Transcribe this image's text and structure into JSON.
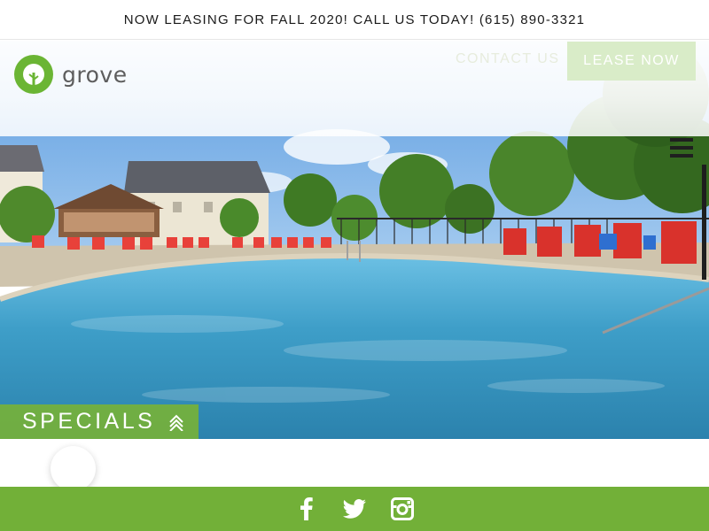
{
  "announcement": {
    "text": "NOW LEASING FOR FALL 2020! CALL US TODAY! (615) 890-3321"
  },
  "header": {
    "logo_text": "grove",
    "logo_icon": "tree-leaf-icon",
    "contact_label": "CONTACT US",
    "lease_label": "LEASE NOW",
    "menu_icon": "hamburger-menu-icon"
  },
  "hero": {
    "image_icon": "pool-photo"
  },
  "specials": {
    "label": "SPECIALS",
    "icon": "double-chevron-up-icon"
  },
  "chat": {
    "icon": "chat-bubble-icon"
  },
  "footer": {
    "social": [
      {
        "name": "facebook",
        "icon": "facebook-icon"
      },
      {
        "name": "twitter",
        "icon": "twitter-icon"
      },
      {
        "name": "instagram",
        "icon": "instagram-icon"
      }
    ]
  },
  "colors": {
    "brand_green": "#72b038",
    "specials_green": "#76b139",
    "lease_button": "#d9ecc8",
    "pool_blue": "#3e9ec8"
  }
}
